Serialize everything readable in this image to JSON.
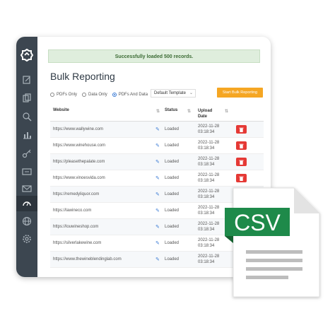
{
  "banner": "Successfully loaded 500 records.",
  "page_title": "Bulk Reporting",
  "options": {
    "pdfs_only": "PDFs Only",
    "data_only": "Data Only",
    "pdfs_and_data": "PDFs And Data",
    "selected": "PDFs And Data"
  },
  "template_select": "Default Template",
  "start_button": "Start Bulk Reporting",
  "table": {
    "headers": {
      "website": "Website",
      "status": "Status",
      "upload_date": "Upload Date"
    },
    "rows": [
      {
        "website": "https://www.wallywine.com",
        "status": "Loaded",
        "date": "2022-11-28",
        "time": "03:18:34"
      },
      {
        "website": "https://www.winehouse.com",
        "status": "Loaded",
        "date": "2022-11-28",
        "time": "03:18:34"
      },
      {
        "website": "https://pleasethepalate.com",
        "status": "Loaded",
        "date": "2022-11-28",
        "time": "03:18:34"
      },
      {
        "website": "https://www.vinoesvida.com",
        "status": "Loaded",
        "date": "2022-11-28",
        "time": "03:18:34"
      },
      {
        "website": "https://remedyliquor.com",
        "status": "Loaded",
        "date": "2022-11-28",
        "time": "03:18:34"
      },
      {
        "website": "https://lawineco.com",
        "status": "Loaded",
        "date": "2022-11-28",
        "time": "03:18:34"
      },
      {
        "website": "https://louwineshop.com",
        "status": "Loaded",
        "date": "2022-11-28",
        "time": "03:18:34"
      },
      {
        "website": "https://silverlakewine.com",
        "status": "Loaded",
        "date": "2022-11-28",
        "time": "03:18:34"
      },
      {
        "website": "https://www.thewineblendinglab.com",
        "status": "Loaded",
        "date": "2022-11-28",
        "time": "03:18:34"
      }
    ]
  },
  "csv_label": "CSV",
  "colors": {
    "sidebar": "#3c4650",
    "accent_orange": "#f5a623",
    "delete_red": "#e53935",
    "csv_green": "#1e8a4a",
    "success_bg": "#dfeedd"
  }
}
